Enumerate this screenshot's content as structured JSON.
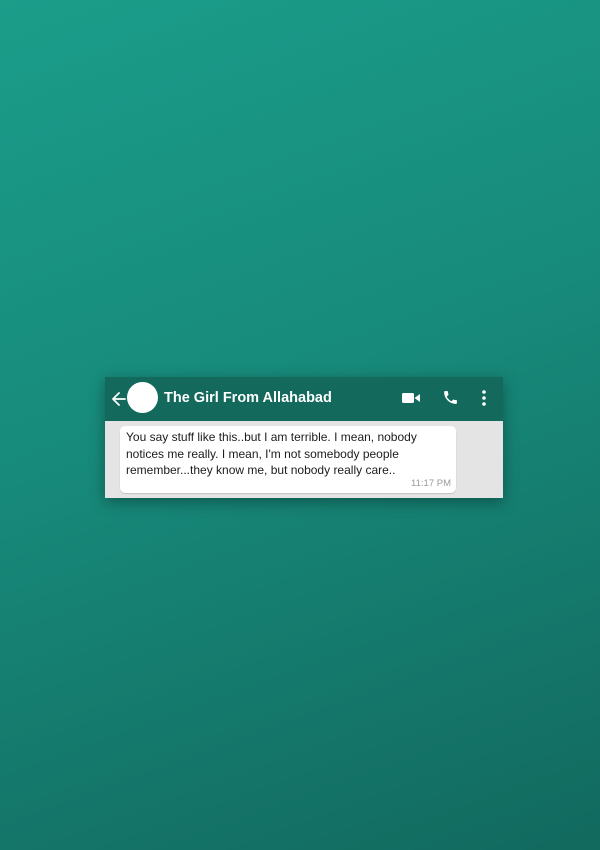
{
  "contact": {
    "name": "The Girl From Allahabad"
  },
  "header": {
    "icons": [
      "back-arrow-icon",
      "avatar",
      "video-call-icon",
      "phone-icon",
      "more-options-icon"
    ]
  },
  "message": {
    "text": "You say stuff like this..but I am terrible. I mean, nobody\nnotices me really.  I mean, I'm not somebody people\nremember...they know me, but nobody really care..",
    "time": "11:17 PM",
    "direction": "incoming"
  },
  "colors": {
    "background_top": "#1b9d8a",
    "background_bottom": "#12695e",
    "header": "#12695c",
    "chat_body": "#e4e4e4",
    "bubble": "#ffffff"
  }
}
